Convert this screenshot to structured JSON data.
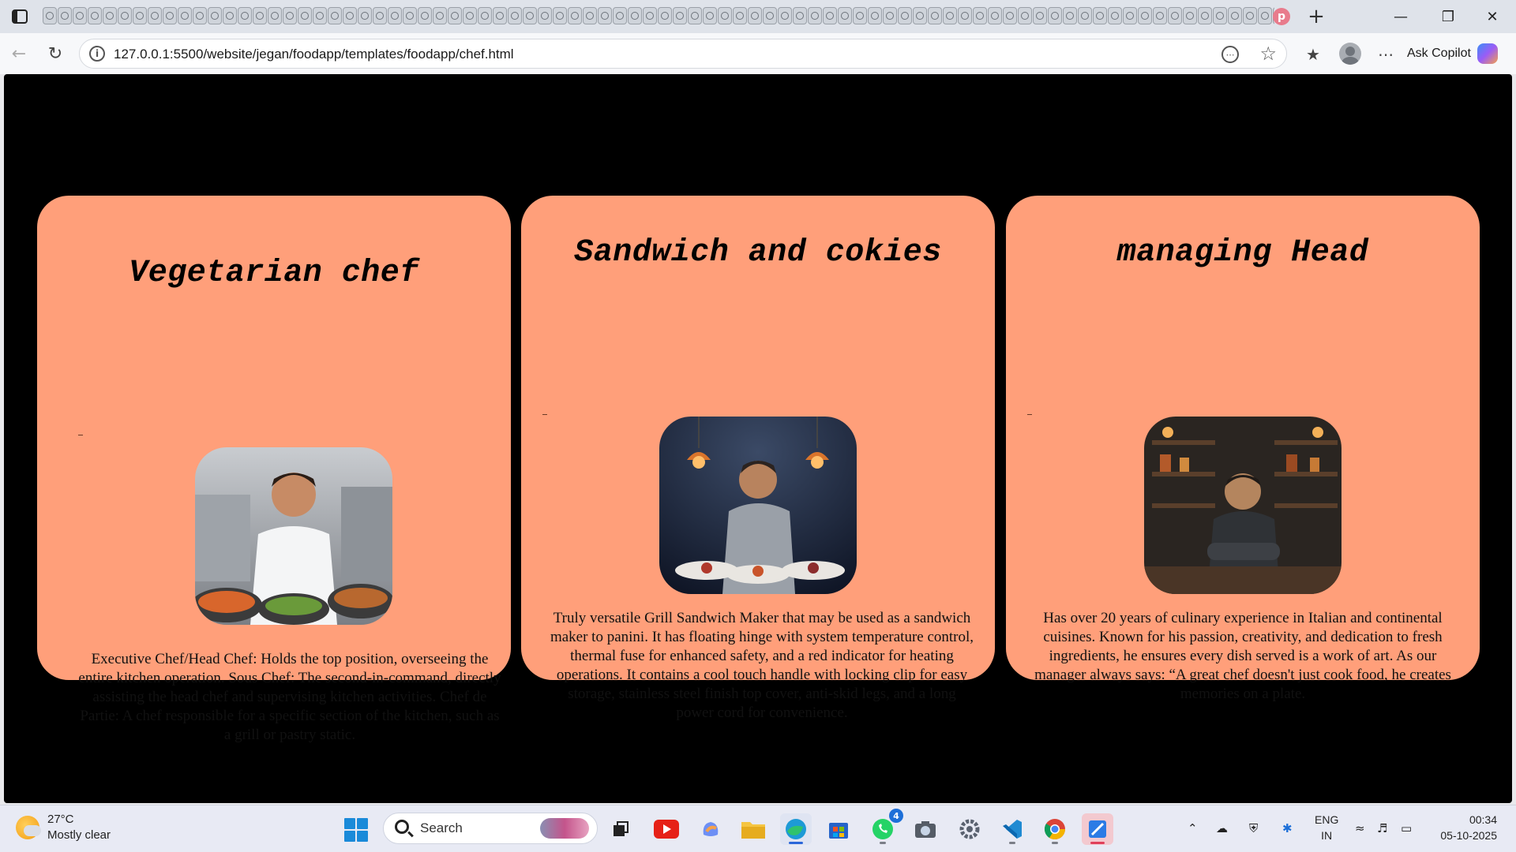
{
  "browser": {
    "url": "127.0.0.1:5500/website/jegan/foodapp/templates/foodapp/chef.html",
    "ask_copilot_label": "Ask Copilot",
    "tab_count": 85
  },
  "page": {
    "background": "#000000",
    "card_color": "#ff9f7a",
    "cards": [
      {
        "title": "Vegetarian chef",
        "image": "chef-with-vegetarian-dishes-photo",
        "description": "Executive Chef/Head Chef: Holds the top position, overseeing the entire kitchen operation. Sous Chef: The second-in-command, directly assisting the head chef and supervising kitchen activities. Chef de Partie: A chef responsible for a specific section of the kitchen, such as a grill or pastry static."
      },
      {
        "title": "Sandwich and cokies",
        "image": "chef-plating-dishes-photo",
        "description": "Truly versatile Grill Sandwich Maker that may be used as a sandwich maker to panini. It has floating hinge with system temperature control, thermal fuse for enhanced safety, and a red indicator for heating operations. It contains a cool touch handle with locking clip for easy storage, stainless steel finish top cover, anti-skid legs, and a long power cord for convenience."
      },
      {
        "title": "managing Head",
        "image": "chef-arms-crossed-in-kitchen-photo",
        "description": "Has over 20 years of culinary experience in Italian and continental cuisines. Known for his passion, creativity, and dedication to fresh ingredients, he ensures every dish served is a work of art. As our manager always says: “A great chef doesn't just cook food, he creates memories on a plate."
      }
    ]
  },
  "taskbar": {
    "weather_temp": "27°C",
    "weather_desc": "Mostly clear",
    "search_label": "Search",
    "whatsapp_badge": "4",
    "lang_line1": "ENG",
    "lang_line2": "IN",
    "time": "00:34",
    "date": "05-10-2025"
  }
}
